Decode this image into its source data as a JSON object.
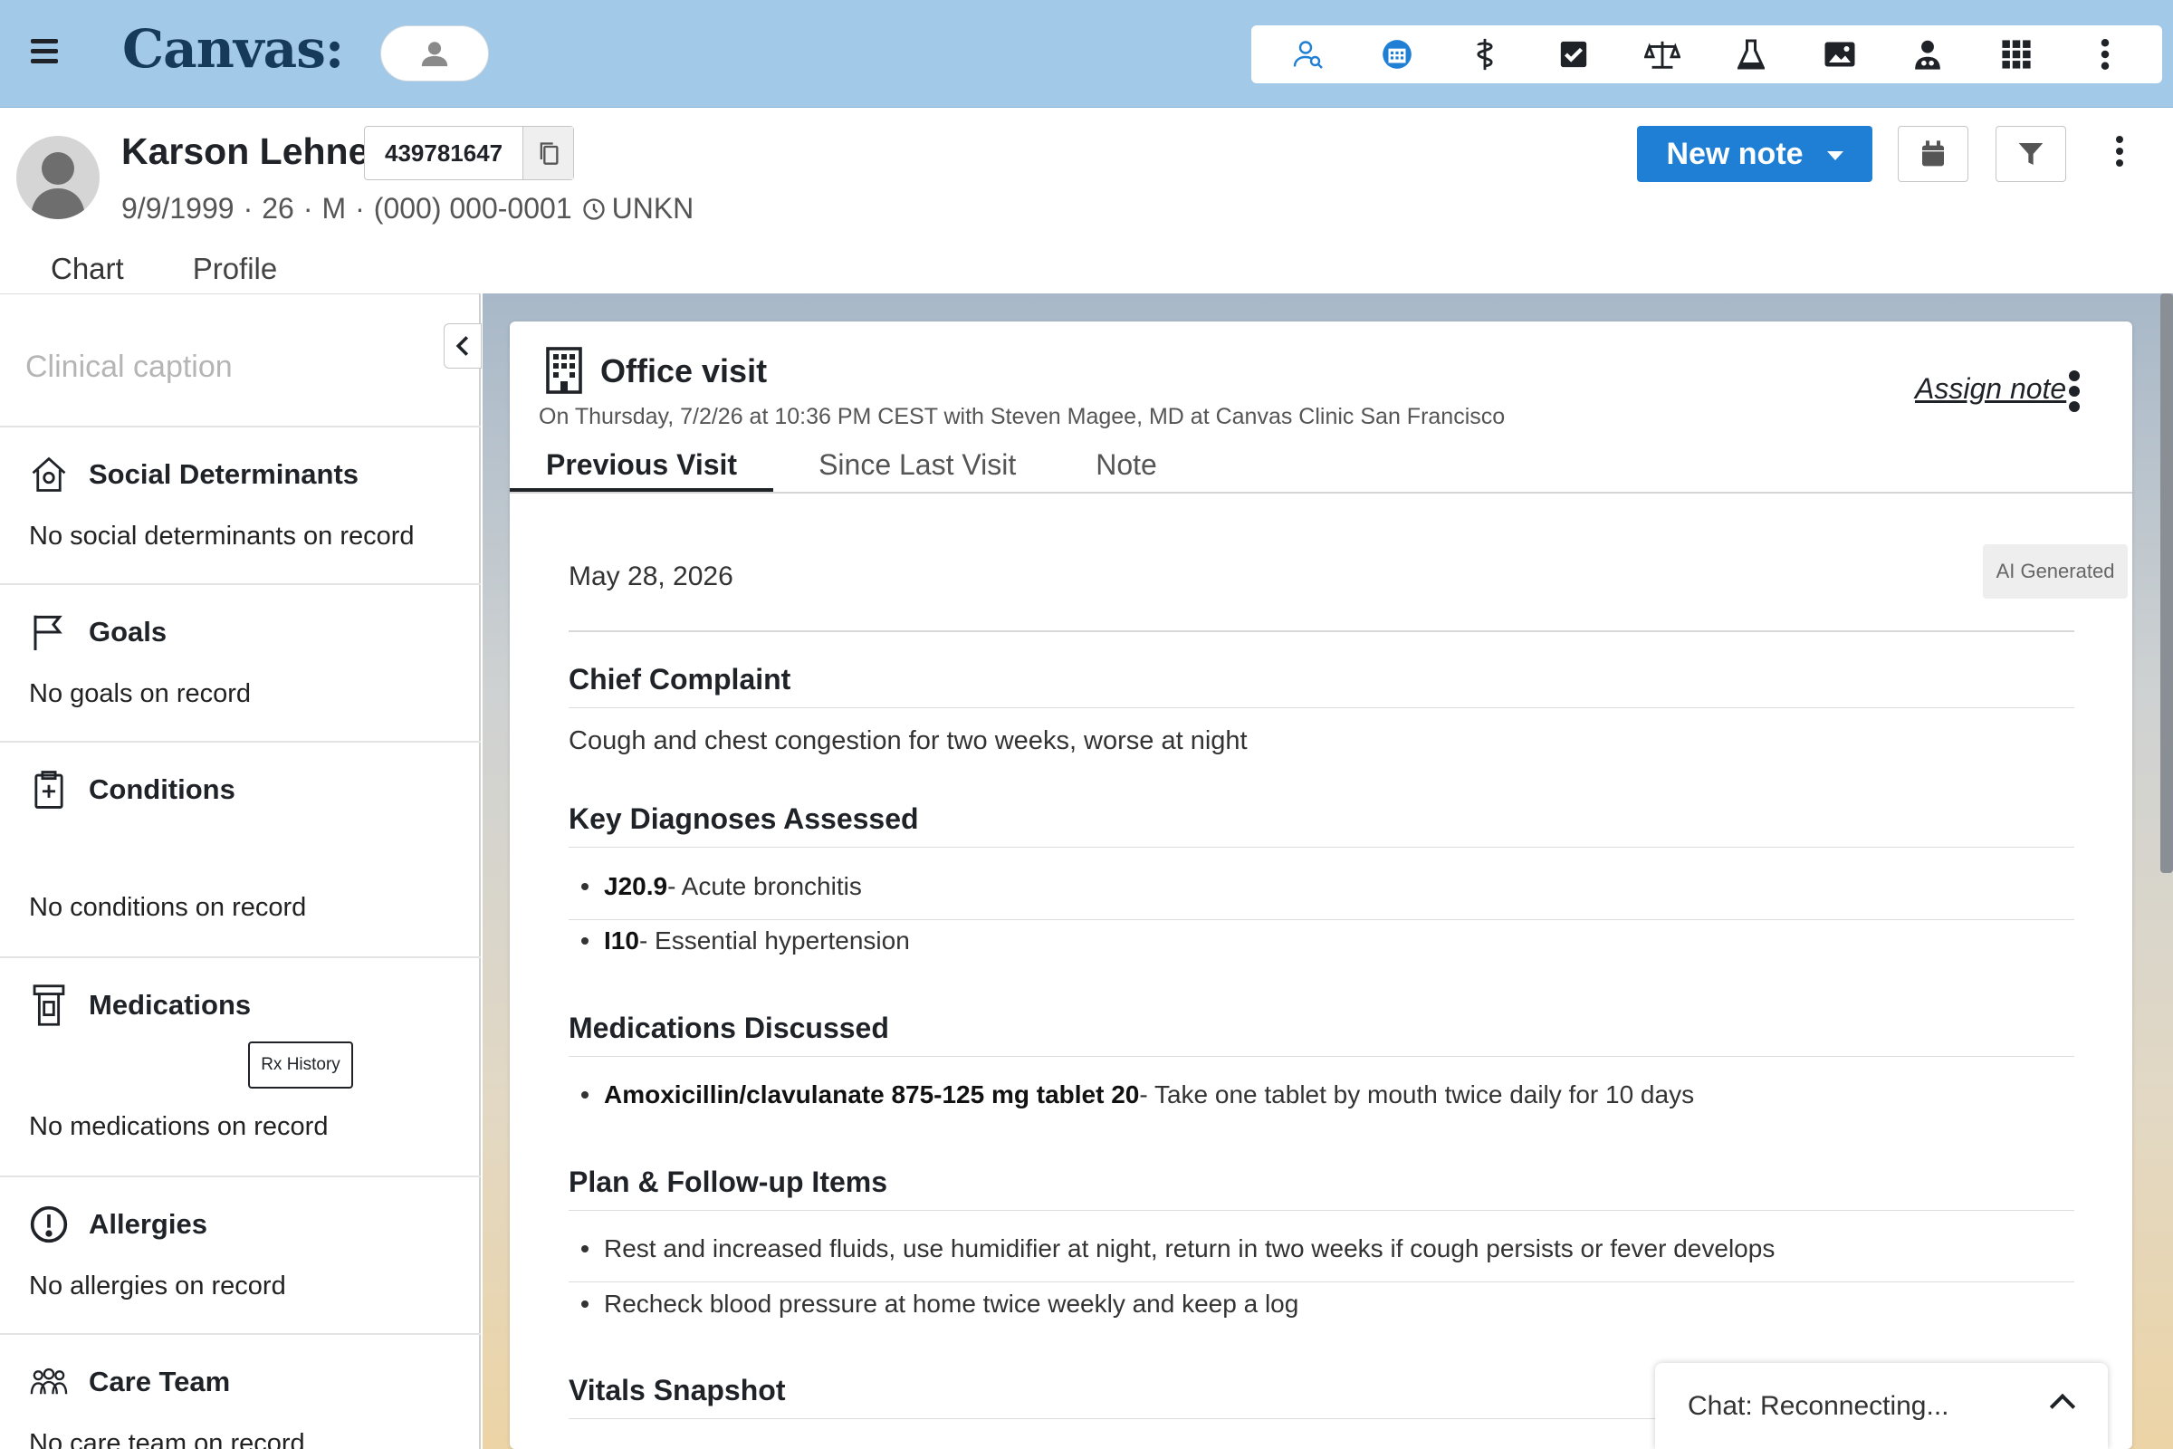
{
  "app": {
    "brand": "Canvas"
  },
  "toolbar": {
    "icons": [
      "patient-lookup-icon",
      "schedule-icon",
      "rx-caduceus-icon",
      "tasks-icon",
      "scales-icon",
      "lab-flask-icon",
      "image-icon",
      "provider-icon",
      "apps-grid-icon",
      "more-icon"
    ],
    "accent": "#1f7fd4"
  },
  "patient": {
    "name": "Karson Lehner",
    "mrn": "439781647",
    "dob": "9/9/1999",
    "age": "26",
    "sex": "M",
    "phone": "(000) 000-0001",
    "timezone": "UNKN"
  },
  "header": {
    "new_note_label": "New note"
  },
  "patient_tabs": [
    "Chart",
    "Profile"
  ],
  "sidebar": {
    "caption_placeholder": "Clinical caption",
    "sections": [
      {
        "title": "Social Determinants",
        "empty": "No social determinants on record",
        "icon": "home-icon"
      },
      {
        "title": "Goals",
        "empty": "No goals on record",
        "icon": "flag-icon"
      },
      {
        "title": "Conditions",
        "empty": "No conditions on record",
        "icon": "clipboard-plus-icon"
      },
      {
        "title": "Medications",
        "empty": "No medications on record",
        "icon": "pill-bottle-icon",
        "action": "Rx History"
      },
      {
        "title": "Allergies",
        "empty": "No allergies on record",
        "icon": "alert-circle-icon"
      },
      {
        "title": "Care Team",
        "empty": "No care team on record",
        "icon": "team-icon"
      }
    ]
  },
  "note": {
    "title": "Office visit",
    "subtitle": "On Thursday, 7/2/26 at 10:36 PM CEST with Steven Magee, MD at Canvas Clinic San Francisco",
    "assign_label": "Assign note",
    "tabs": [
      "Previous Visit",
      "Since Last Visit",
      "Note"
    ],
    "date": "May 28, 2026",
    "badge": "AI Generated",
    "chief_complaint": {
      "heading": "Chief Complaint",
      "text": "Cough and chest congestion for two weeks, worse at night"
    },
    "diagnoses": {
      "heading": "Key Diagnoses Assessed",
      "items": [
        {
          "code": "J20.9",
          "desc": " - Acute bronchitis"
        },
        {
          "code": "I10",
          "desc": " - Essential hypertension"
        }
      ]
    },
    "medications": {
      "heading": "Medications Discussed",
      "items": [
        {
          "name": "Amoxicillin/clavulanate 875-125 mg tablet 20",
          "desc": " - Take one tablet by mouth twice daily for 10 days"
        }
      ]
    },
    "plan": {
      "heading": "Plan & Follow-up Items",
      "items": [
        "Rest and increased fluids, use humidifier at night, return in two weeks if cough persists or fever develops",
        "Recheck blood pressure at home twice weekly and keep a log"
      ]
    },
    "vitals": {
      "heading": "Vitals Snapshot"
    }
  },
  "chat": {
    "status": "Chat: Reconnecting..."
  }
}
